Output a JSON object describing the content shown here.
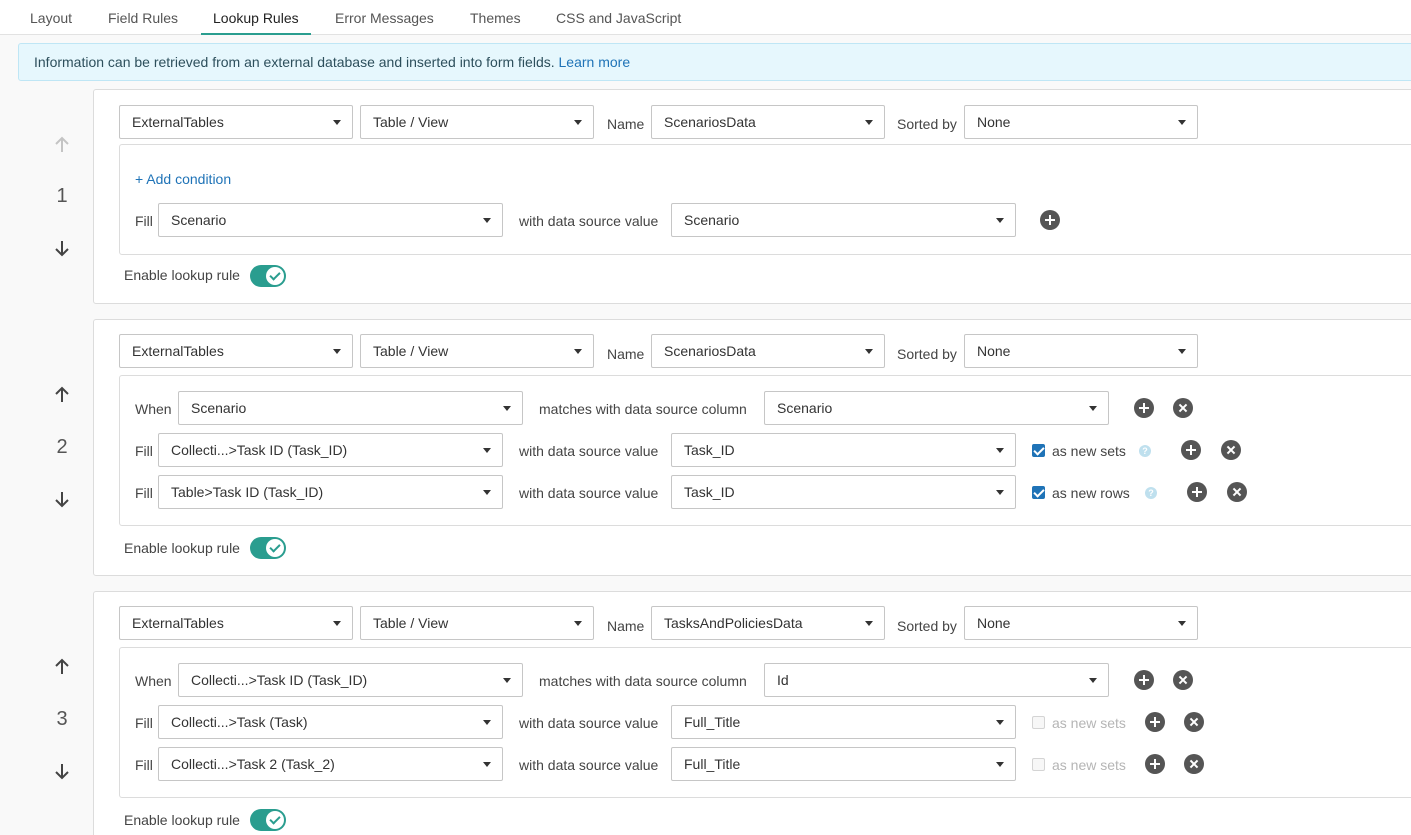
{
  "tabs": [
    "Layout",
    "Field Rules",
    "Lookup Rules",
    "Error Messages",
    "Themes",
    "CSS and JavaScript"
  ],
  "active_tab": "Lookup Rules",
  "info": {
    "text": "Information can be retrieved from an external database and inserted into form fields.",
    "link": "Learn more"
  },
  "labels": {
    "name": "Name",
    "sorted_by": "Sorted by",
    "fill": "Fill",
    "with_value": "with data source value",
    "when": "When",
    "matches": "matches with data source column",
    "add_condition": "+ Add condition",
    "enable": "Enable lookup rule"
  },
  "colors": {
    "accent": "#2a9d8f",
    "link": "#1f73b7",
    "info_bg": "#e6f7fd"
  },
  "rules": [
    {
      "number": "1",
      "source": "ExternalTables",
      "type": "Table / View",
      "name": "ScenariosData",
      "sorted_by": "None",
      "fills": [
        {
          "field": "Scenario",
          "value": "Scenario"
        }
      ],
      "enabled": true
    },
    {
      "number": "2",
      "source": "ExternalTables",
      "type": "Table / View",
      "name": "ScenariosData",
      "sorted_by": "None",
      "condition": {
        "field": "Scenario",
        "column": "Scenario"
      },
      "fills": [
        {
          "field": "Collecti...>Task ID (Task_ID)",
          "value": "Task_ID",
          "option": "as new sets",
          "checked": true
        },
        {
          "field": "Table>Task ID (Task_ID)",
          "value": "Task_ID",
          "option": "as new rows",
          "checked": true
        }
      ],
      "enabled": true
    },
    {
      "number": "3",
      "source": "ExternalTables",
      "type": "Table / View",
      "name": "TasksAndPoliciesData",
      "sorted_by": "None",
      "condition": {
        "field": "Collecti...>Task ID (Task_ID)",
        "column": "Id"
      },
      "fills": [
        {
          "field": "Collecti...>Task (Task)",
          "value": "Full_Title",
          "option": "as new sets",
          "checked": false
        },
        {
          "field": "Collecti...>Task 2 (Task_2)",
          "value": "Full_Title",
          "option": "as new sets",
          "checked": false
        }
      ],
      "enabled": true
    }
  ]
}
